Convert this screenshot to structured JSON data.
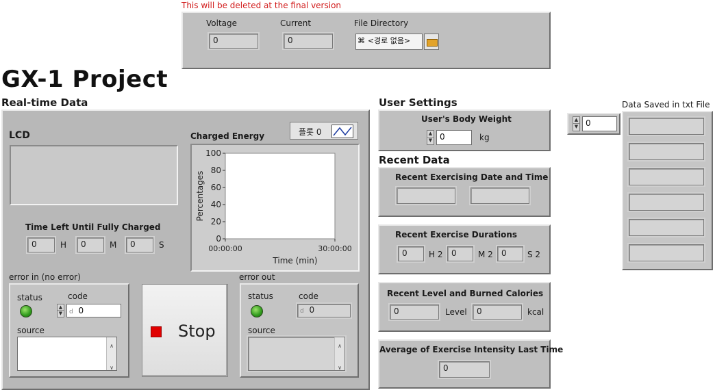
{
  "dev_note": "This will be deleted at the final version",
  "top_panel": {
    "voltage_label": "Voltage",
    "voltage_value": "0",
    "current_label": "Current",
    "current_value": "0",
    "file_dir_label": "File Directory",
    "file_dir_value": "<경로 없음>"
  },
  "title": "GX-1 Project",
  "realtime": {
    "section_label": "Real-time Data",
    "lcd_label": "LCD",
    "time_left_label": "Time Left Until Fully Charged",
    "hours_value": "0",
    "hours_unit": "H",
    "minutes_value": "0",
    "minutes_unit": "M",
    "seconds_value": "0",
    "seconds_unit": "S"
  },
  "chart": {
    "title": "Charged Energy",
    "plot_legend": "플롯 0",
    "ylabel": "Percentages",
    "xlabel": "Time (min)",
    "y_ticks": [
      "100",
      "80",
      "60",
      "40",
      "20",
      "0"
    ],
    "x_start": "00:00:00",
    "x_end": "30:00:00"
  },
  "chart_data": {
    "type": "line",
    "title": "Charged Energy",
    "xlabel": "Time (min)",
    "ylabel": "Percentages",
    "ylim": [
      0,
      100
    ],
    "xlim": [
      "00:00:00",
      "30:00:00"
    ],
    "legend": "top-right",
    "series": [
      {
        "name": "플롯 0",
        "values": []
      }
    ],
    "grid": false
  },
  "error_in": {
    "label": "error in (no error)",
    "status_label": "status",
    "code_label": "code",
    "code_value": "0",
    "code_prefix": "d",
    "source_label": "source"
  },
  "stop_button": {
    "label": "Stop"
  },
  "error_out": {
    "label": "error out",
    "status_label": "status",
    "code_label": "code",
    "code_value": "0",
    "code_prefix": "d",
    "source_label": "source"
  },
  "user_settings": {
    "section_label": "User Settings",
    "weight_label": "User's Body Weight",
    "weight_value": "0",
    "weight_unit": "kg"
  },
  "recent": {
    "section_label": "Recent Data",
    "date_time_label": "Recent Exercising Date and Time",
    "durations_label": "Recent Exercise Durations",
    "dur_h_value": "0",
    "dur_h_unit": "H 2",
    "dur_m_value": "0",
    "dur_m_unit": "M 2",
    "dur_s_value": "0",
    "dur_s_unit": "S 2",
    "level_cal_label": "Recent Level and Burned Calories",
    "level_value": "0",
    "level_unit": "Level",
    "kcal_value": "0",
    "kcal_unit": "kcal",
    "intensity_label": "Average of Exercise Intensity Last Time",
    "intensity_value": "0"
  },
  "saved": {
    "label": "Data Saved in txt File",
    "index_value": "0",
    "rows": [
      "",
      "",
      "",
      "",
      "",
      ""
    ]
  }
}
